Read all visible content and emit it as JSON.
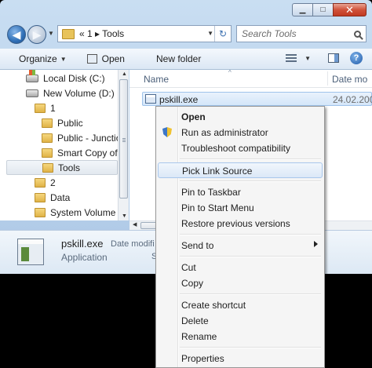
{
  "window": {
    "close_glyph": "✕",
    "min_glyph": "▁",
    "max_glyph": "□"
  },
  "nav": {
    "back_glyph": "◀",
    "fwd_glyph": "▶",
    "breadcrumb": "« 1 ▸ Tools",
    "refresh_glyph": "↻",
    "search_placeholder": "Search Tools"
  },
  "toolbar": {
    "organize": "Organize",
    "open": "Open",
    "new_folder": "New folder"
  },
  "tree": {
    "items": [
      {
        "label": "Local Disk (C:)"
      },
      {
        "label": "New Volume (D:)"
      },
      {
        "label": "1"
      },
      {
        "label": "Public"
      },
      {
        "label": "Public - Junctio"
      },
      {
        "label": "Smart Copy of T"
      },
      {
        "label": "Tools"
      },
      {
        "label": "2"
      },
      {
        "label": "Data"
      },
      {
        "label": "System Volume Ir"
      }
    ]
  },
  "content": {
    "col_name": "Name",
    "col_date": "Date mo",
    "file": {
      "name": "pskill.exe",
      "date": "24.02.200"
    }
  },
  "details": {
    "name": "pskill.exe",
    "type": "Application",
    "label_date": "Date modifi",
    "label_size": "Si"
  },
  "menu": {
    "items": [
      {
        "label": "Open"
      },
      {
        "label": "Run as administrator"
      },
      {
        "label": "Troubleshoot compatibility"
      },
      {
        "label": "Pick Link Source"
      },
      {
        "label": "Pin to Taskbar"
      },
      {
        "label": "Pin to Start Menu"
      },
      {
        "label": "Restore previous versions"
      },
      {
        "label": "Send to"
      },
      {
        "label": "Cut"
      },
      {
        "label": "Copy"
      },
      {
        "label": "Create shortcut"
      },
      {
        "label": "Delete"
      },
      {
        "label": "Rename"
      },
      {
        "label": "Properties"
      }
    ]
  },
  "colors": {
    "selection_border": "#9fc3ea",
    "close_button": "#c13a21",
    "frame": "#b7d0ea"
  }
}
